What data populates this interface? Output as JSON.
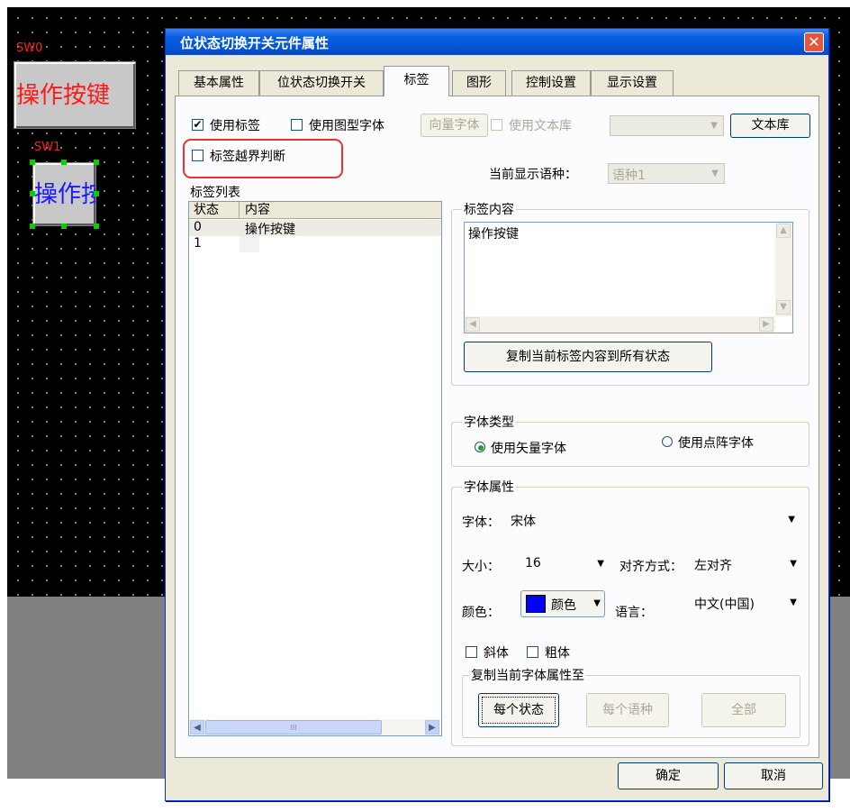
{
  "canvas": {
    "sw0": {
      "label": "SW0",
      "text": "操作按键"
    },
    "sw1": {
      "label": "SW1",
      "text": "操作按"
    }
  },
  "dialog": {
    "title": "位状态切换开关元件属性",
    "tabs": [
      "基本属性",
      "位状态切换开关",
      "标签",
      "图形",
      "控制设置",
      "显示设置"
    ],
    "active_tab": "标签",
    "use_label": {
      "label": "使用标签",
      "checked": true
    },
    "use_graphic_font": {
      "label": "使用图型字体",
      "checked": false
    },
    "vector_font_button": "向量字体",
    "use_text_library": {
      "label": "使用文本库",
      "checked": false
    },
    "text_library_button": "文本库",
    "label_bounds_check": {
      "label": "标签越界判断",
      "checked": false
    },
    "current_language_label": "当前显示语种：",
    "current_language_value": "语种1",
    "label_list": {
      "title": "标签列表",
      "columns": [
        "状态",
        "内容"
      ],
      "rows": [
        {
          "state": "0",
          "content": "操作按键"
        },
        {
          "state": "1",
          "content": ""
        }
      ],
      "scroll_grip": "III"
    },
    "label_content": {
      "title": "标签内容",
      "text": "操作按键",
      "copy_button": "复制当前标签内容到所有状态"
    },
    "font_type": {
      "title": "字体类型",
      "vector": "使用矢量字体",
      "dot_matrix": "使用点阵字体",
      "selected": "vector"
    },
    "font_props": {
      "title": "字体属性",
      "font_label": "字体：",
      "font_value": "宋体",
      "size_label": "大小：",
      "size_value": "16",
      "align_label": "对齐方式：",
      "align_value": "左对齐",
      "color_label": "颜色：",
      "color_button": "颜色",
      "color_swatch": "#0000ff",
      "lang_label": "语言：",
      "lang_value": "中文(中国)",
      "italic": "斜体",
      "bold": "粗体",
      "copy_group_title": "复制当前字体属性至",
      "each_state": "每个状态",
      "each_language": "每个语种",
      "all": "全部"
    },
    "ok": "确定",
    "cancel": "取消"
  },
  "colors": {
    "highlight": "#e8322c",
    "titlebar": "#0256d8",
    "sw_label": "#ff2020"
  }
}
